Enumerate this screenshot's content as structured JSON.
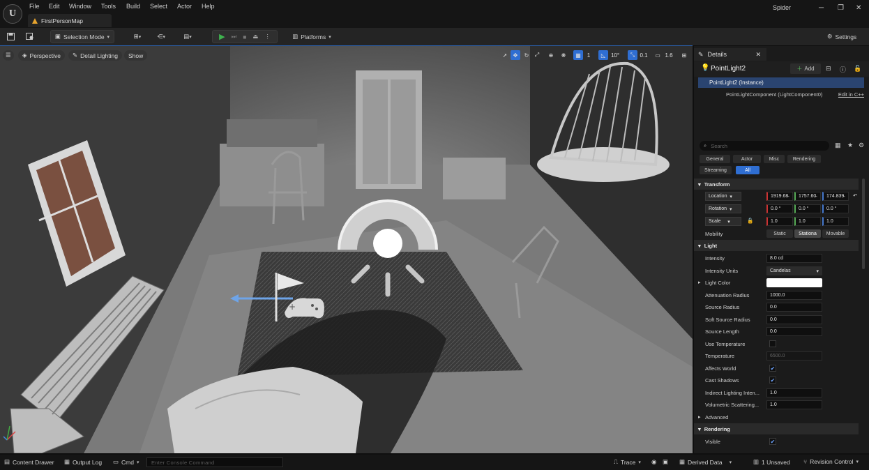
{
  "app": {
    "map_tab": "FirstPersonMap",
    "user": "Spider"
  },
  "menu": [
    "File",
    "Edit",
    "Window",
    "Tools",
    "Build",
    "Select",
    "Actor",
    "Help"
  ],
  "toolbar": {
    "selection_mode": "Selection Mode",
    "platforms": "Platforms",
    "settings": "Settings"
  },
  "viewport": {
    "perspective": "Perspective",
    "lighting": "Detail Lighting",
    "show": "Show",
    "grid_value": "1",
    "angle_value": "10°",
    "scale_value": "0.1",
    "camera_speed": "1.6"
  },
  "details": {
    "tab_title": "Details",
    "actor_name": "PointLight2",
    "add_label": "Add",
    "instance_label": "PointLight2 (Instance)",
    "component_label": "PointLightComponent (LightComponent0)",
    "edit_cpp": "Edit in C++",
    "search_placeholder": "Search",
    "filters": [
      "General",
      "Actor",
      "Misc",
      "Rendering",
      "Streaming",
      "All"
    ],
    "transform": {
      "section": "Transform",
      "location_label": "Location",
      "location": [
        "1919.68̵",
        "1757.60̵",
        "174.839̵"
      ],
      "rotation_label": "Rotation",
      "rotation": [
        "0.0 °",
        "0.0 °",
        "0.0 °"
      ],
      "scale_label": "Scale",
      "scale": [
        "1.0",
        "1.0",
        "1.0"
      ],
      "mobility_label": "Mobility",
      "mobility_options": [
        "Static",
        "Stationa",
        "Movable"
      ]
    },
    "light": {
      "section": "Light",
      "intensity_label": "Intensity",
      "intensity": "8.0 cd",
      "units_label": "Intensity Units",
      "units": "Candelas",
      "color_label": "Light Color",
      "atten_label": "Attenuation Radius",
      "atten": "1000.0",
      "source_radius_label": "Source Radius",
      "source_radius": "0.0",
      "soft_radius_label": "Soft Source Radius",
      "soft_radius": "0.0",
      "source_length_label": "Source Length",
      "source_length": "0.0",
      "use_temp_label": "Use Temperature",
      "temp_label": "Temperature",
      "temp": "6500.0",
      "affects_world_label": "Affects World",
      "cast_shadows_label": "Cast Shadows",
      "indirect_label": "Indirect Lighting Inten...",
      "indirect": "1.0",
      "volumetric_label": "Volumetric Scattering...",
      "volumetric": "1.0"
    },
    "advanced": "Advanced",
    "rendering_section": "Rendering",
    "visible_label": "Visible"
  },
  "status": {
    "content_drawer": "Content Drawer",
    "output_log": "Output Log",
    "cmd": "Cmd",
    "console_placeholder": "Enter Console Command",
    "trace": "Trace",
    "derived_data": "Derived Data",
    "unsaved": "1 Unsaved",
    "revision": "Revision Control"
  }
}
